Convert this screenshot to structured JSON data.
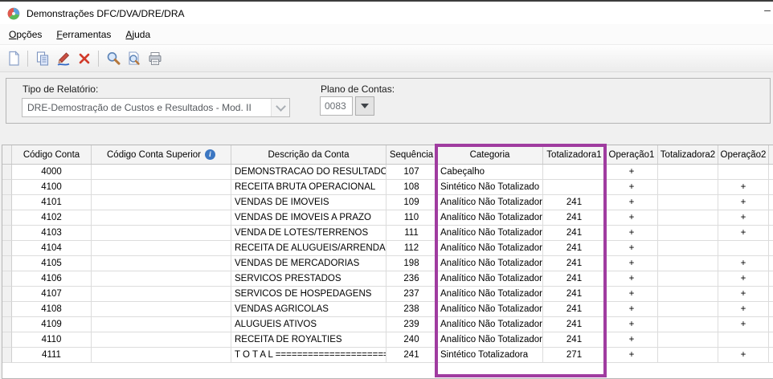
{
  "window": {
    "title": "Demonstrações DFC/DVA/DRE/DRA",
    "minimize_glyph": "–"
  },
  "menu": {
    "items": [
      {
        "accel": "O",
        "rest": "pções"
      },
      {
        "accel": "F",
        "rest": "erramentas"
      },
      {
        "accel": "A",
        "rest": "juda"
      }
    ]
  },
  "toolbar": {
    "icons": [
      "new-document",
      "copy",
      "edit",
      "delete",
      "search",
      "search-document",
      "print"
    ]
  },
  "filters": {
    "tipo_label": "Tipo de Relatório:",
    "tipo_value": "DRE-Demostração de Custos e Resultados - Mod. II",
    "plano_label": "Plano de Contas:",
    "plano_value": "0083"
  },
  "grid": {
    "info_icon_glyph": "i",
    "columns": [
      "Código Conta",
      "Código Conta Superior",
      "Descrição da Conta",
      "Sequência",
      "Categoria",
      "Totalizadora1",
      "Operação1",
      "Totalizadora2",
      "Operação2"
    ],
    "row_fields": [
      "codigo",
      "superior",
      "descricao",
      "sequencia",
      "categoria",
      "totalizadora1",
      "operacao1",
      "totalizadora2",
      "operacao2"
    ],
    "rows": [
      {
        "codigo": "4000",
        "superior": "",
        "descricao": "DEMONSTRACAO DO RESULTADO DO EXERCICIO",
        "sequencia": "107",
        "categoria": "Cabeçalho",
        "totalizadora1": "",
        "operacao1": "+",
        "totalizadora2": "",
        "operacao2": ""
      },
      {
        "codigo": "4100",
        "superior": "",
        "descricao": "RECEITA BRUTA OPERACIONAL",
        "sequencia": "108",
        "categoria": "Sintético Não Totalizado",
        "totalizadora1": "",
        "operacao1": "+",
        "totalizadora2": "",
        "operacao2": "+"
      },
      {
        "codigo": "4101",
        "superior": "",
        "descricao": "VENDAS DE IMOVEIS",
        "sequencia": "109",
        "categoria": "Analítico Não Totalizador",
        "totalizadora1": "241",
        "operacao1": "+",
        "totalizadora2": "",
        "operacao2": "+"
      },
      {
        "codigo": "4102",
        "superior": "",
        "descricao": "VENDAS DE IMOVEIS A PRAZO",
        "sequencia": "110",
        "categoria": "Analítico Não Totalizador",
        "totalizadora1": "241",
        "operacao1": "+",
        "totalizadora2": "",
        "operacao2": "+"
      },
      {
        "codigo": "4103",
        "superior": "",
        "descricao": "VENDA DE LOTES/TERRENOS",
        "sequencia": "111",
        "categoria": "Analítico Não Totalizador",
        "totalizadora1": "241",
        "operacao1": "+",
        "totalizadora2": "",
        "operacao2": "+"
      },
      {
        "codigo": "4104",
        "superior": "",
        "descricao": "RECEITA DE ALUGUEIS/ARRENDAMENTO",
        "sequencia": "112",
        "categoria": "Analítico Não Totalizador",
        "totalizadora1": "241",
        "operacao1": "+",
        "totalizadora2": "",
        "operacao2": ""
      },
      {
        "codigo": "4105",
        "superior": "",
        "descricao": "VENDAS DE MERCADORIAS",
        "sequencia": "198",
        "categoria": "Analítico Não Totalizador",
        "totalizadora1": "241",
        "operacao1": "+",
        "totalizadora2": "",
        "operacao2": "+"
      },
      {
        "codigo": "4106",
        "superior": "",
        "descricao": "SERVICOS PRESTADOS",
        "sequencia": "236",
        "categoria": "Analítico Não Totalizador",
        "totalizadora1": "241",
        "operacao1": "+",
        "totalizadora2": "",
        "operacao2": "+"
      },
      {
        "codigo": "4107",
        "superior": "",
        "descricao": "SERVICOS DE HOSPEDAGENS",
        "sequencia": "237",
        "categoria": "Analítico Não Totalizador",
        "totalizadora1": "241",
        "operacao1": "+",
        "totalizadora2": "",
        "operacao2": "+"
      },
      {
        "codigo": "4108",
        "superior": "",
        "descricao": "VENDAS AGRICOLAS",
        "sequencia": "238",
        "categoria": "Analítico Não Totalizador",
        "totalizadora1": "241",
        "operacao1": "+",
        "totalizadora2": "",
        "operacao2": "+"
      },
      {
        "codigo": "4109",
        "superior": "",
        "descricao": "ALUGUEIS ATIVOS",
        "sequencia": "239",
        "categoria": "Analítico Não Totalizador",
        "totalizadora1": "241",
        "operacao1": "+",
        "totalizadora2": "",
        "operacao2": "+"
      },
      {
        "codigo": "4110",
        "superior": "",
        "descricao": "RECEITA DE ROYALTIES",
        "sequencia": "240",
        "categoria": "Analítico Não Totalizador",
        "totalizadora1": "241",
        "operacao1": "+",
        "totalizadora2": "",
        "operacao2": ""
      },
      {
        "codigo": "4111",
        "superior": "",
        "descricao": "T O T A L ========================",
        "sequencia": "241",
        "categoria": "Sintético Totalizadora",
        "totalizadora1": "271",
        "operacao1": "+",
        "totalizadora2": "",
        "operacao2": "+"
      }
    ]
  },
  "highlight": {
    "color": "#a03ca0"
  }
}
